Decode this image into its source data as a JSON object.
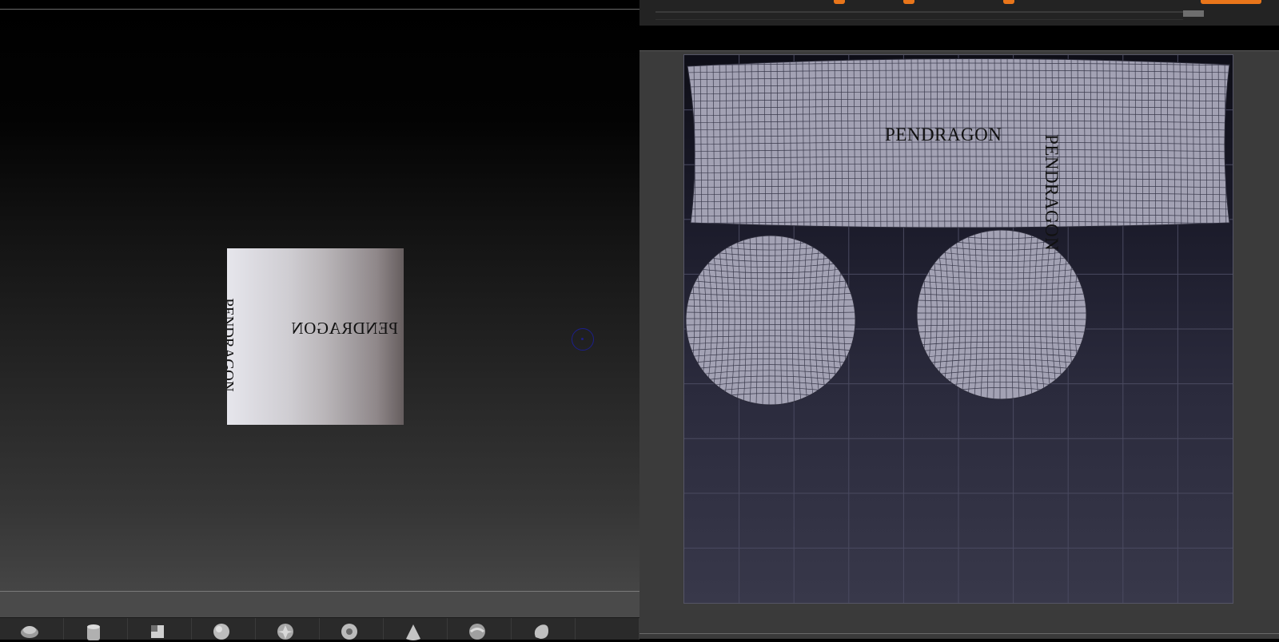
{
  "left_viewport": {
    "model_label_horizontal": "PENDRAGON",
    "model_label_vertical": "PENDRAGON"
  },
  "tool_shelf": {
    "items": [
      {
        "name": "tool-rotate"
      },
      {
        "name": "tool-cylinder"
      },
      {
        "name": "tool-cube"
      },
      {
        "name": "tool-sphere"
      },
      {
        "name": "tool-star"
      },
      {
        "name": "tool-ring"
      },
      {
        "name": "tool-cone"
      },
      {
        "name": "tool-sphere-2"
      },
      {
        "name": "tool-blob"
      }
    ]
  },
  "uv_editor": {
    "strip_label_horizontal": "PENDRAGON",
    "strip_label_vertical": "PENDRAGON",
    "grid_divisions": 10
  },
  "colors": {
    "accent": "#e8751a",
    "cursor": "#1c1f8a"
  }
}
